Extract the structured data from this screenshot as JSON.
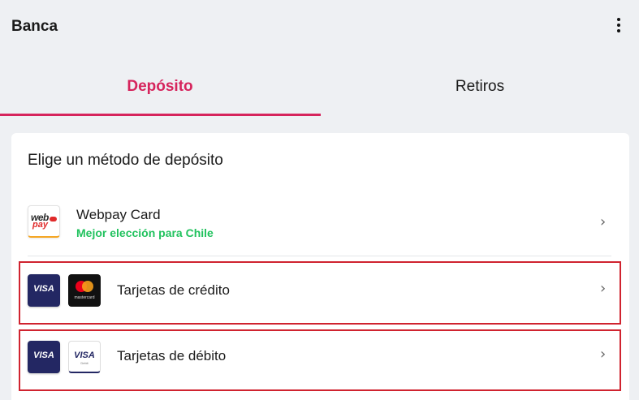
{
  "header": {
    "title": "Banca",
    "menu_icon": "more-vertical-icon"
  },
  "tabs": [
    {
      "label": "Depósito",
      "active": true
    },
    {
      "label": "Retiros",
      "active": false
    }
  ],
  "accent_color": "#d6245c",
  "highlight_color": "#d0232f",
  "card": {
    "title": "Elige un método de depósito",
    "methods": [
      {
        "label": "Webpay Card",
        "sublabel": "Mejor elección para Chile",
        "icons": [
          "webpay-logo-icon"
        ],
        "logo_text_top": "web",
        "logo_text_bottom": "pay"
      },
      {
        "label": "Tarjetas de crédito",
        "icons": [
          "visa-icon",
          "mastercard-icon"
        ],
        "visa_text": "VISA",
        "mc_text": "mastercard"
      },
      {
        "label": "Tarjetas de débito",
        "icons": [
          "visa-icon",
          "visa-debit-icon"
        ],
        "visa_text": "VISA",
        "visa_debit_text": "VISA",
        "visa_debit_sub": "Debit"
      }
    ]
  },
  "chevron_glyph": "›"
}
